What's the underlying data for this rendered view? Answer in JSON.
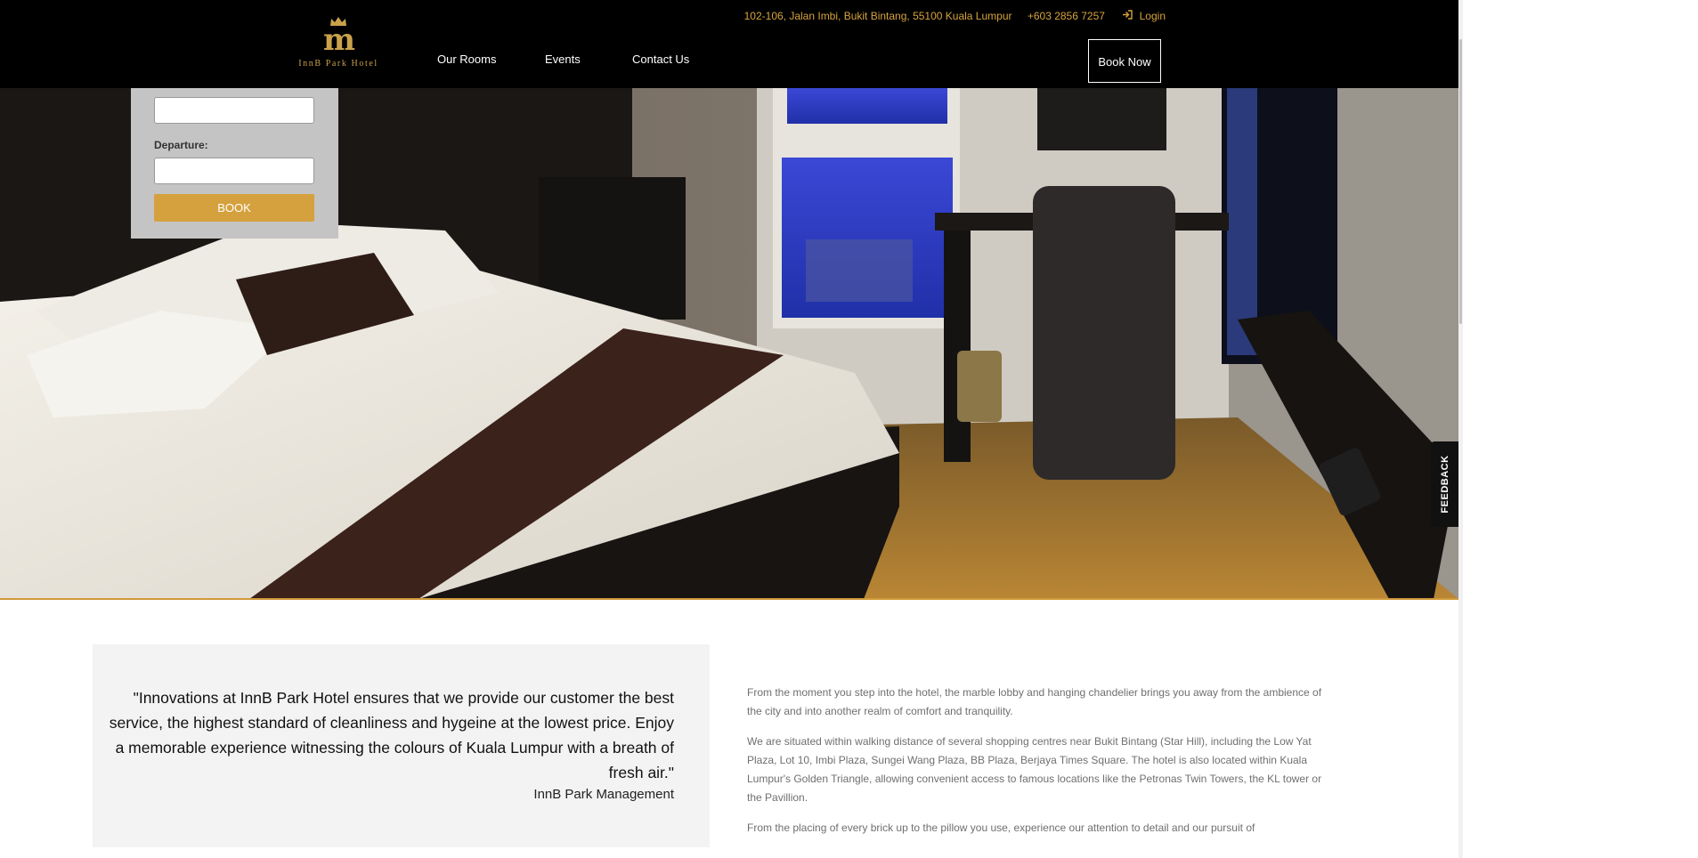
{
  "header": {
    "logo_mark": "m",
    "logo_name": "InnB Park Hotel",
    "address": "102-106, Jalan Imbi, Bukit Bintang, 55100 Kuala Lumpur",
    "phone": "+603 2856 7257",
    "login_label": "Login",
    "nav": {
      "rooms": "Our Rooms",
      "events": "Events",
      "contact": "Contact Us"
    },
    "book_now": "Book Now"
  },
  "booking": {
    "arrival_value": "",
    "departure_label": "Departure:",
    "departure_value": "",
    "book_label": "BOOK"
  },
  "feedback": {
    "label": "FEEDBACK"
  },
  "quote": {
    "text": "\"Innovations at InnB Park Hotel ensures that we provide our customer the best service, the highest standard of cleanliness and hygeine at the lowest price. Enjoy a memorable experience witnessing the colours of Kuala Lumpur with a breath of fresh air.\"",
    "author": "InnB Park Management"
  },
  "description": {
    "p1": "From the moment you step into the hotel, the marble lobby and hanging chandelier brings you away from the ambience of the city and into another realm of comfort and tranquility.",
    "p2": "We are situated within walking distance of several shopping centres near Bukit Bintang (Star Hill), including the Low Yat Plaza, Lot 10, Imbi Plaza, Sungei Wang Plaza, BB Plaza, Berjaya Times Square. The hotel is also located within Kuala Lumpur's Golden Triangle, allowing convenient access to famous locations like the Petronas Twin Towers, the KL tower or the Pavillion.",
    "p3": "From the placing of every brick up to the pillow you use, experience our attention to detail and our pursuit of"
  },
  "colors": {
    "accent": "#d5a13e",
    "header_bg": "#000000",
    "quote_bg": "#f3f3f3",
    "body_text": "#6f6f6f"
  }
}
